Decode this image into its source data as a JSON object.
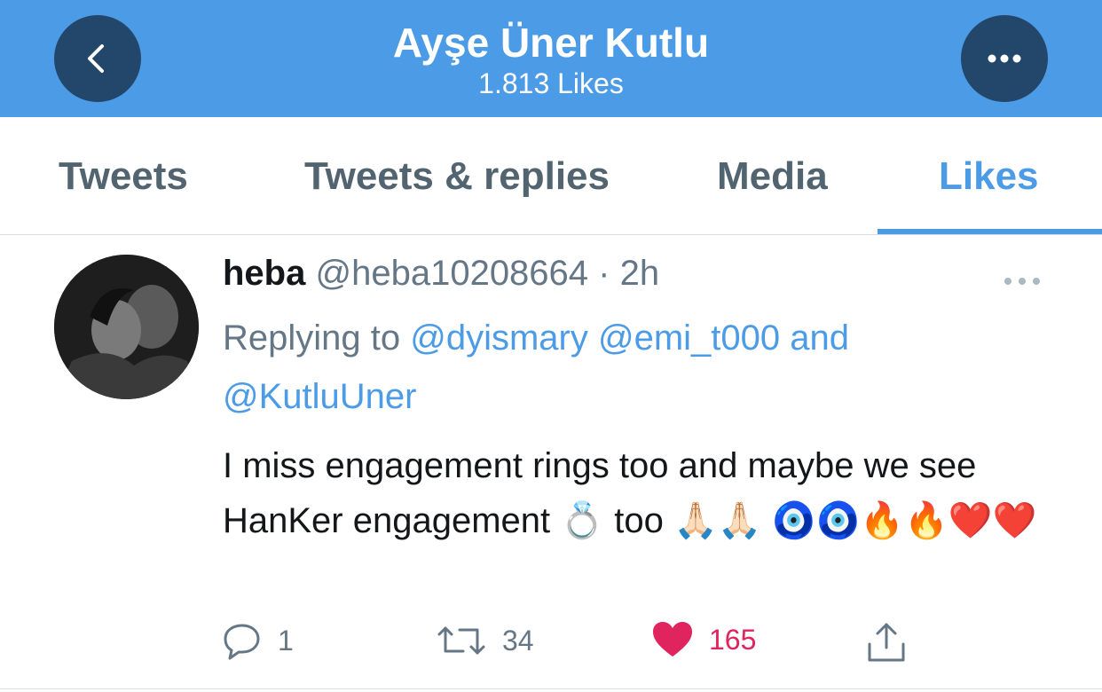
{
  "header": {
    "title": "Ayşe Üner Kutlu",
    "subtitle": "1.813 Likes",
    "back_icon": "chevron-left-icon",
    "more_icon": "more-dots-icon"
  },
  "tabs": [
    {
      "label": "Tweets"
    },
    {
      "label": "Tweets & replies"
    },
    {
      "label": "Media"
    },
    {
      "label": "Likes",
      "active": true
    }
  ],
  "tweet": {
    "name": "heba",
    "handle": "@heba10208664",
    "separator": "·",
    "time": "2h",
    "reply_prefix": "Replying to",
    "mention_1": "@dyismary",
    "mention_2": "@emi_t000",
    "reply_and": "and",
    "mention_3": "@KutluUner",
    "text_1": "I miss engagement rings too and maybe we see HanKer engagement",
    "emoji_ring": "💍",
    "text_2": "too",
    "emoji_line": "🙏🏻🙏🏻 🧿🧿🔥🔥❤️❤️",
    "replies": "1",
    "retweets": "34",
    "likes": "165"
  },
  "colors": {
    "header_bg": "#4c9be6",
    "header_button": "#23476b",
    "accent": "#4c9be6",
    "like": "#e0245e",
    "muted": "#657786"
  }
}
